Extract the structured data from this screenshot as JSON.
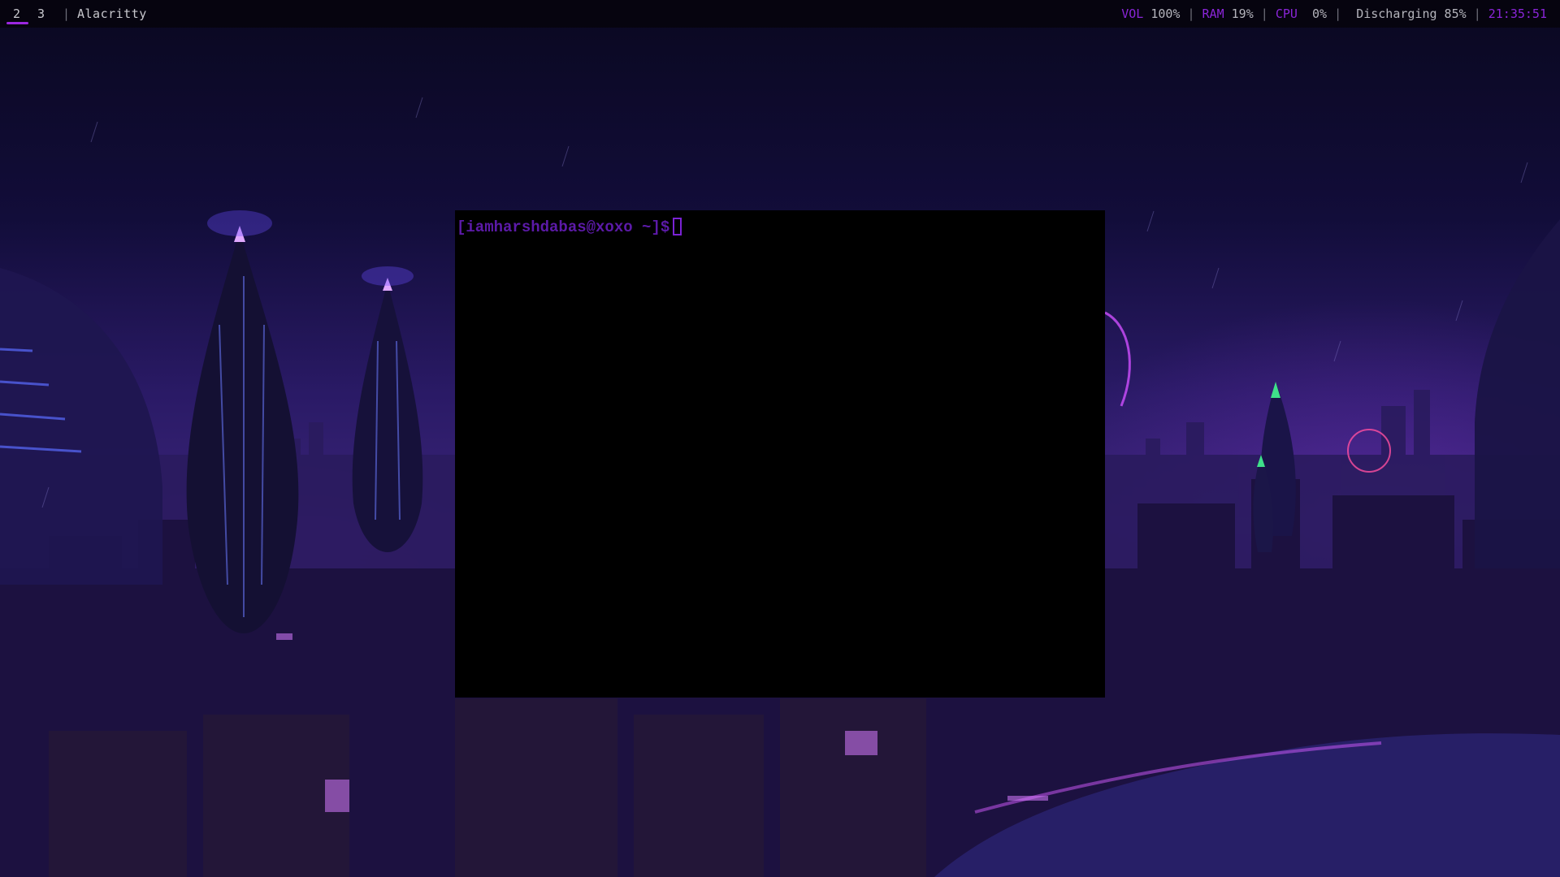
{
  "topbar": {
    "workspaces": [
      {
        "label": "2",
        "active": true
      },
      {
        "label": "3",
        "active": false
      }
    ],
    "separator": "|",
    "window_title": "Alacritty",
    "status": {
      "vol_label": "VOL",
      "vol_value": "100%",
      "ram_label": "RAM",
      "ram_value": "19%",
      "cpu_label": "CPU",
      "cpu_value": "0%",
      "battery": "Discharging 85%",
      "clock": "21:35:51"
    }
  },
  "terminal": {
    "prompt": "[iamharshdabas@xoxo ~]$"
  },
  "colors": {
    "accent": "#8a25d8",
    "bar_bg": "#06040e",
    "terminal_bg": "#000000",
    "prompt_color": "#5c1aa8"
  }
}
